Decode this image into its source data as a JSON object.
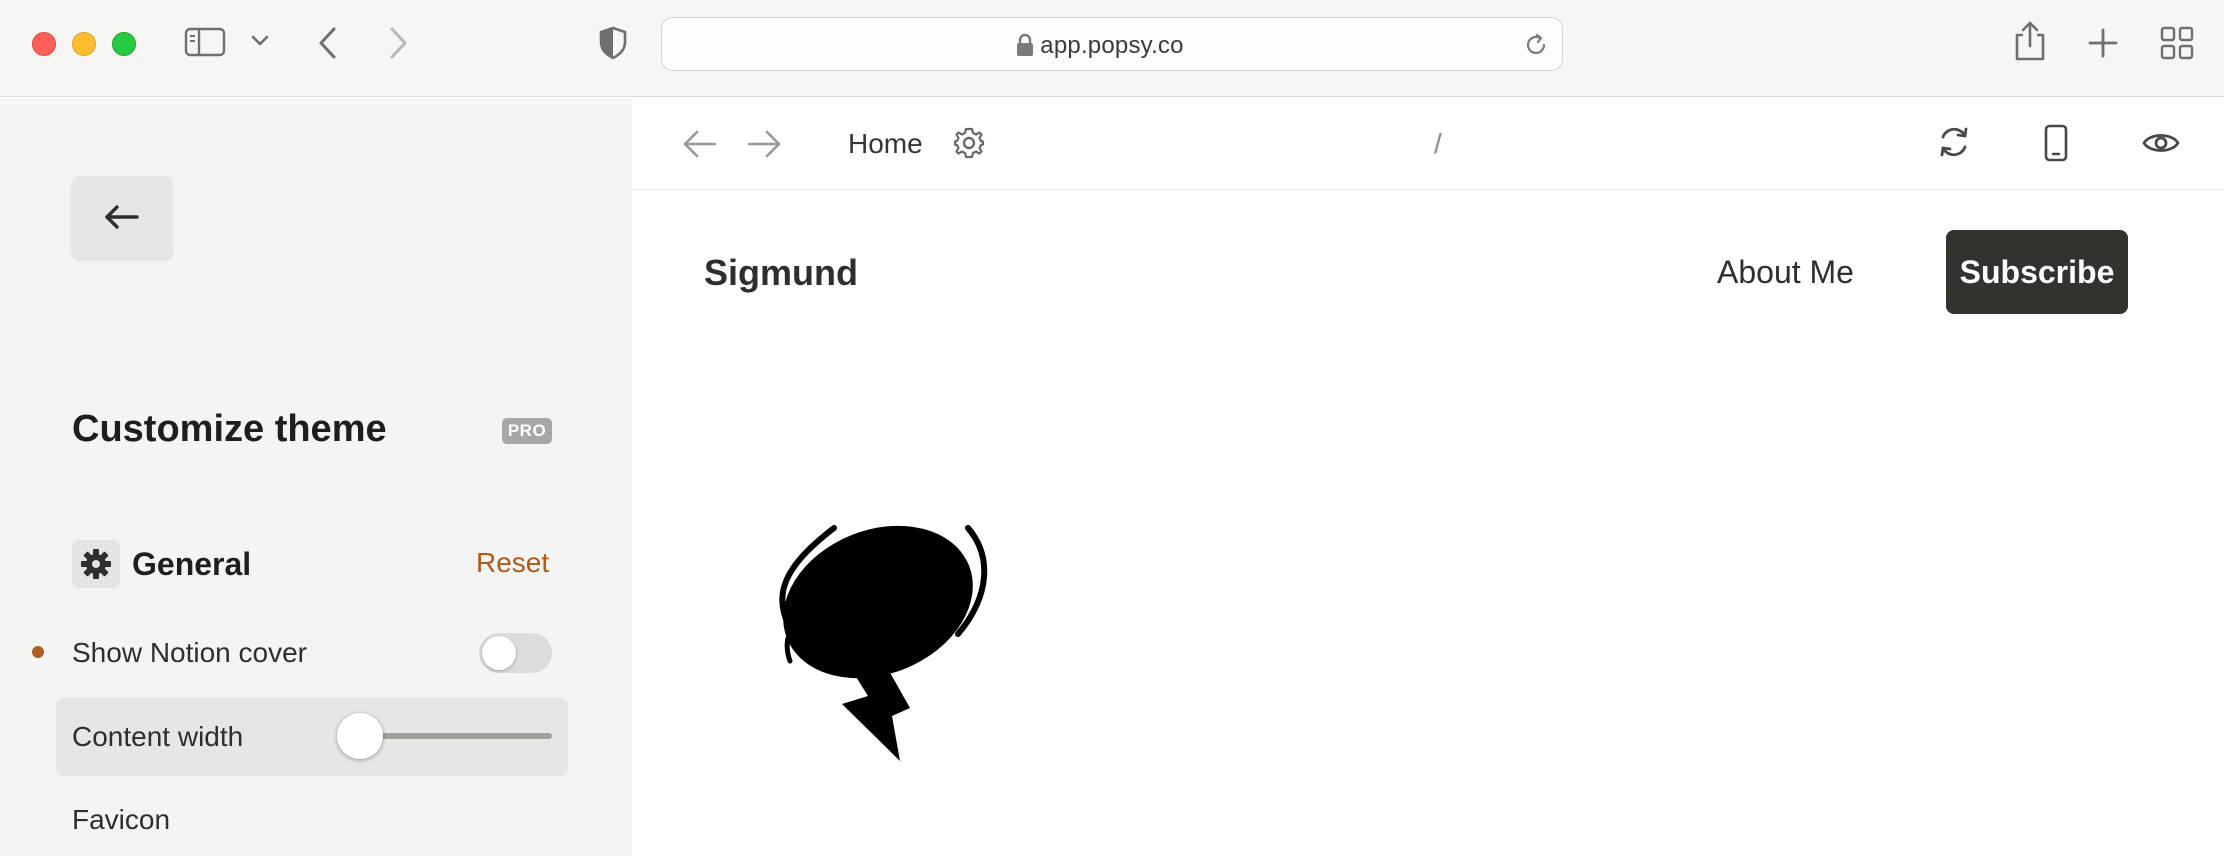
{
  "browser": {
    "url": "app.popsy.co"
  },
  "sidebar": {
    "title": "Customize theme",
    "badge": "PRO",
    "section": {
      "title": "General",
      "reset_label": "Reset"
    },
    "settings": [
      {
        "label": "Show Notion cover",
        "control": "toggle",
        "enabled": false,
        "modified": true
      },
      {
        "label": "Content width",
        "control": "slider",
        "value_fraction": 0.09
      },
      {
        "label": "Favicon"
      }
    ]
  },
  "preview": {
    "breadcrumb_page": "Home",
    "path": "/",
    "site": {
      "name": "Sigmund",
      "nav_link": "About Me",
      "cta_label": "Subscribe"
    }
  },
  "colors": {
    "accent": "#ad5a1c",
    "cta_background": "#33322e",
    "sidebar_background": "#f4f4f3"
  },
  "icons": [
    "sidebar-toggle-icon",
    "chevron-down-icon",
    "back-icon",
    "forward-icon",
    "shield-icon",
    "lock-icon",
    "reload-icon",
    "share-icon",
    "new-tab-icon",
    "tab-overview-icon",
    "arrow-left-icon",
    "gear-icon",
    "refresh-icon",
    "mobile-icon",
    "eye-icon",
    "speech-bubble-logo-icon"
  ]
}
